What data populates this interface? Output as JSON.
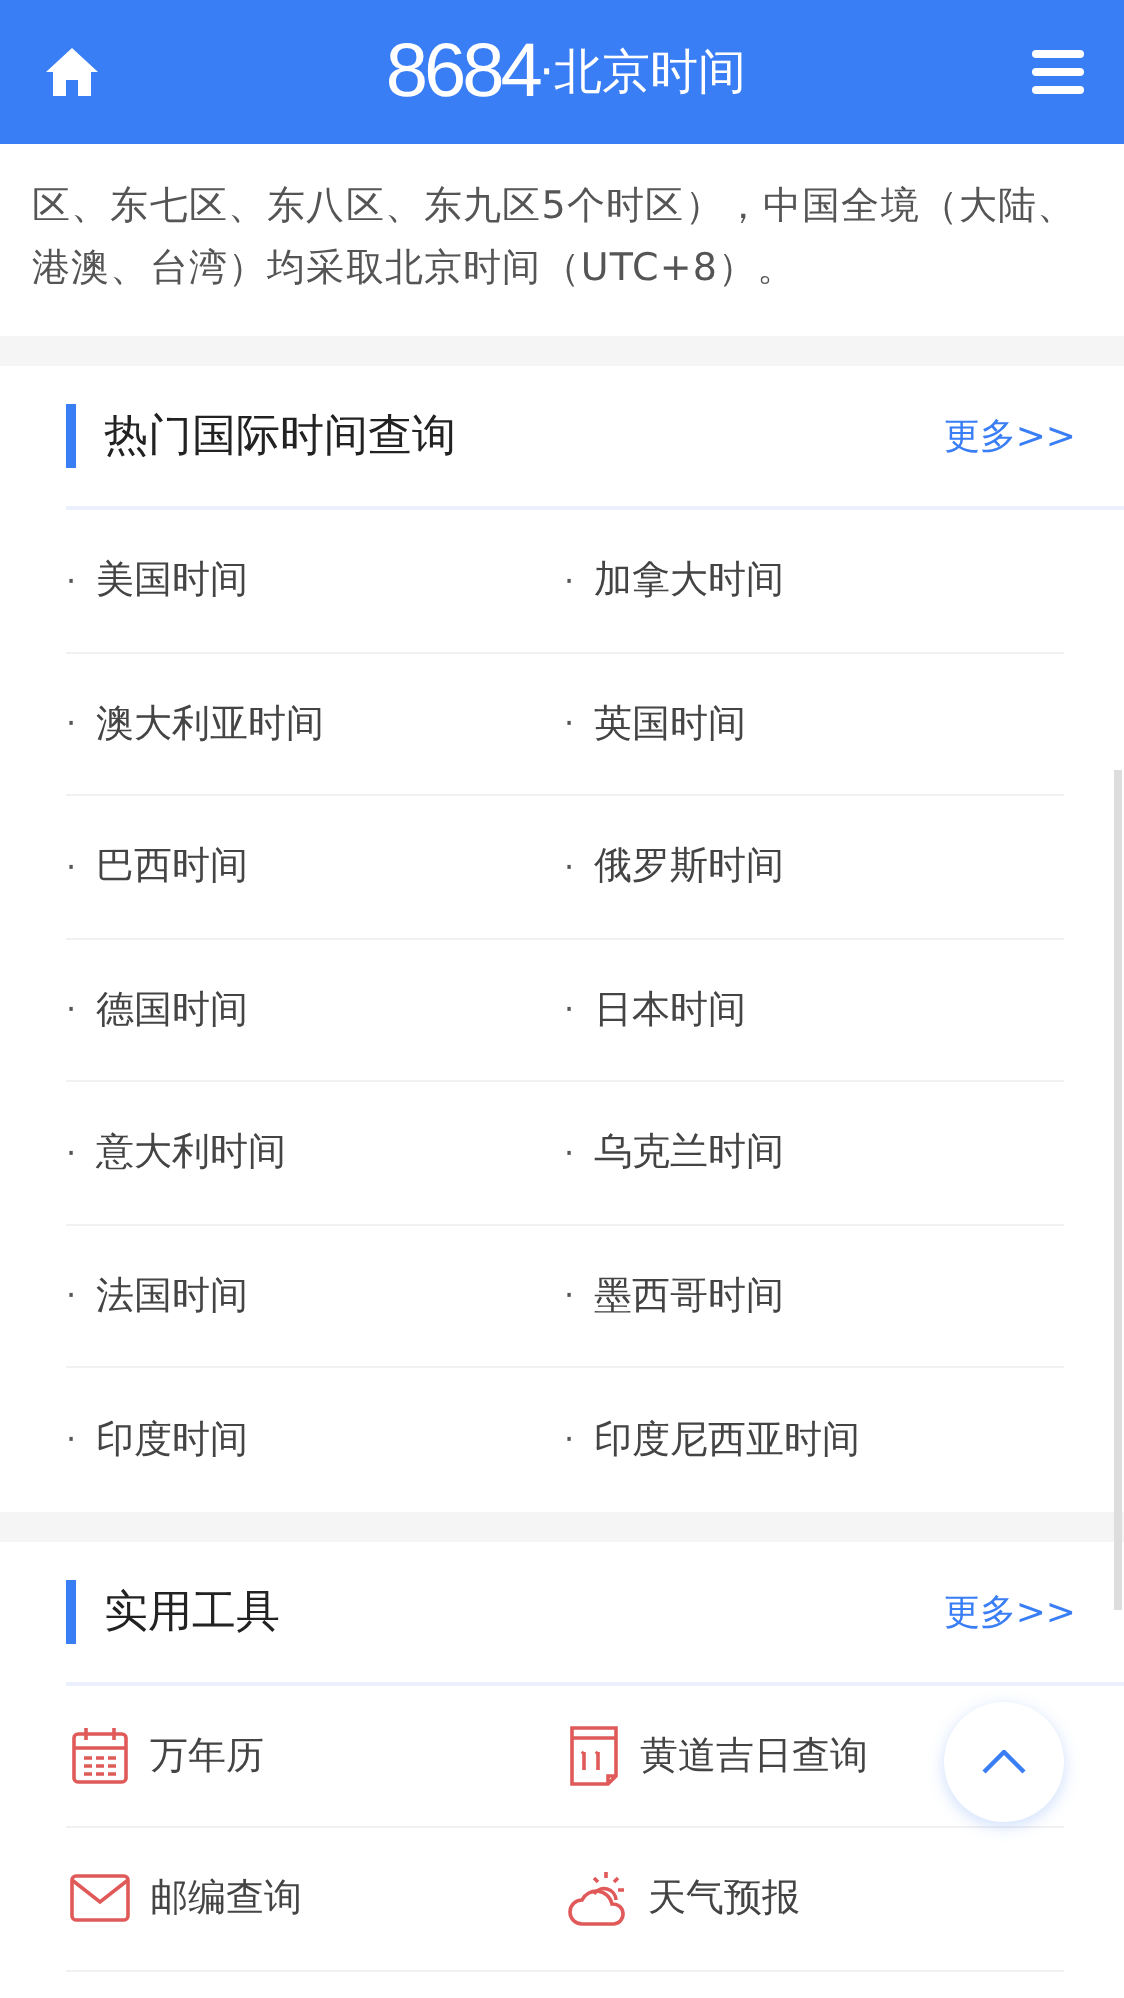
{
  "header": {
    "logo_number": "8684",
    "logo_text": "·北京时间"
  },
  "intro": "区、东七区、东八区、东九区5个时区），中国全境（大陆、港澳、台湾）均采取北京时间（UTC+8）。",
  "sections": [
    {
      "kind": "links",
      "title": "热门国际时间查询",
      "more": "更多>>",
      "items": [
        {
          "bullet": "·",
          "label": "美国时间"
        },
        {
          "bullet": "·",
          "label": "加拿大时间"
        },
        {
          "bullet": "·",
          "label": "澳大利亚时间"
        },
        {
          "bullet": "·",
          "label": "英国时间"
        },
        {
          "bullet": "·",
          "label": "巴西时间"
        },
        {
          "bullet": "·",
          "label": "俄罗斯时间"
        },
        {
          "bullet": "·",
          "label": "德国时间"
        },
        {
          "bullet": "·",
          "label": "日本时间"
        },
        {
          "bullet": "·",
          "label": "意大利时间"
        },
        {
          "bullet": "·",
          "label": "乌克兰时间"
        },
        {
          "bullet": "·",
          "label": "法国时间"
        },
        {
          "bullet": "·",
          "label": "墨西哥时间"
        },
        {
          "bullet": "·",
          "label": "印度时间"
        },
        {
          "bullet": "·",
          "label": "印度尼西亚时间"
        }
      ]
    },
    {
      "kind": "tools",
      "title": "实用工具",
      "more": "更多>>",
      "items": [
        {
          "kind": "calendar",
          "label": "万年历"
        },
        {
          "kind": "date",
          "label": "黄道吉日查询"
        },
        {
          "kind": "mail",
          "label": "邮编查询"
        },
        {
          "kind": "weather",
          "label": "天气预报"
        }
      ]
    }
  ]
}
